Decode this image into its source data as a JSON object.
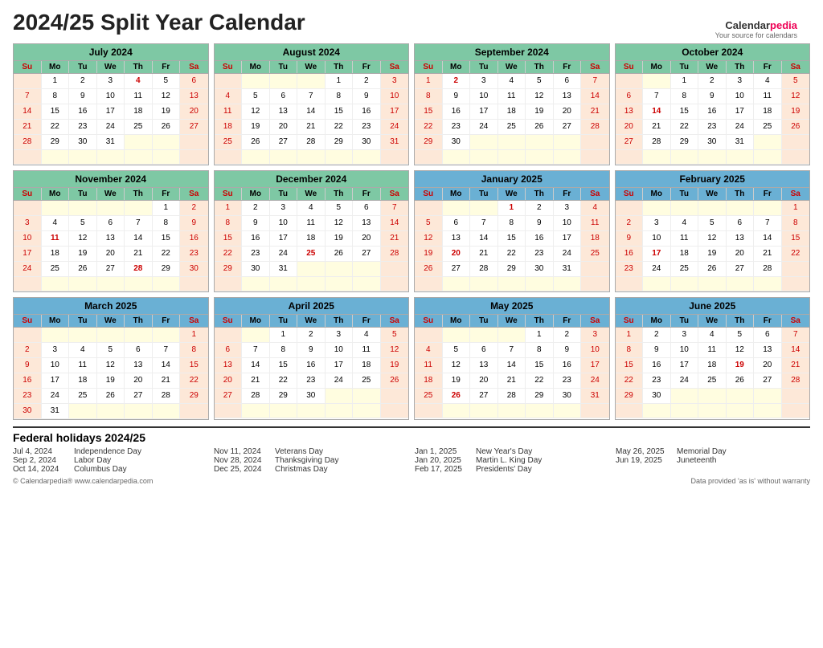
{
  "title": "2024/25 Split Year Calendar",
  "logo": {
    "text1": "Calendar",
    "text2": "pedia",
    "tagline": "Your source for calendars"
  },
  "months": [
    {
      "name": "July 2024",
      "headerClass": "green",
      "startDay": 1,
      "days": 31,
      "year": 2024,
      "holidays": [
        4
      ]
    },
    {
      "name": "August 2024",
      "headerClass": "green",
      "startDay": 4,
      "days": 31,
      "year": 2024,
      "holidays": []
    },
    {
      "name": "September 2024",
      "headerClass": "green",
      "startDay": 0,
      "days": 30,
      "year": 2024,
      "holidays": [
        2
      ]
    },
    {
      "name": "October 2024",
      "headerClass": "green",
      "startDay": 2,
      "days": 31,
      "year": 2024,
      "holidays": [
        14
      ]
    },
    {
      "name": "November 2024",
      "headerClass": "green",
      "startDay": 5,
      "days": 30,
      "year": 2024,
      "holidays": [
        11,
        28
      ]
    },
    {
      "name": "December 2024",
      "headerClass": "green",
      "startDay": 0,
      "days": 31,
      "year": 2024,
      "holidays": [
        25
      ]
    },
    {
      "name": "January 2025",
      "headerClass": "blue",
      "startDay": 3,
      "days": 31,
      "year": 2025,
      "holidays": [
        1,
        20
      ]
    },
    {
      "name": "February 2025",
      "headerClass": "blue",
      "startDay": 6,
      "days": 28,
      "year": 2025,
      "holidays": [
        17
      ]
    },
    {
      "name": "March 2025",
      "headerClass": "blue",
      "startDay": 6,
      "days": 31,
      "year": 2025,
      "holidays": []
    },
    {
      "name": "April 2025",
      "headerClass": "blue",
      "startDay": 2,
      "days": 30,
      "year": 2025,
      "holidays": []
    },
    {
      "name": "May 2025",
      "headerClass": "blue",
      "startDay": 4,
      "days": 31,
      "year": 2025,
      "holidays": [
        26
      ]
    },
    {
      "name": "June 2025",
      "headerClass": "blue",
      "startDay": 0,
      "days": 30,
      "year": 2025,
      "holidays": [
        19
      ]
    }
  ],
  "dayHeaders": [
    "Su",
    "Mo",
    "Tu",
    "We",
    "Th",
    "Fr",
    "Sa"
  ],
  "holidays": [
    {
      "date": "Jul 4, 2024",
      "name": "Independence Day"
    },
    {
      "date": "Sep 2, 2024",
      "name": "Labor Day"
    },
    {
      "date": "Oct 14, 2024",
      "name": "Columbus Day"
    },
    {
      "date": "Nov 11, 2024",
      "name": "Veterans Day"
    },
    {
      "date": "Nov 28, 2024",
      "name": "Thanksgiving Day"
    },
    {
      "date": "Dec 25, 2024",
      "name": "Christmas Day"
    },
    {
      "date": "Jan 1, 2025",
      "name": "New Year's Day"
    },
    {
      "date": "Jan 20, 2025",
      "name": "Martin L. King Day"
    },
    {
      "date": "Feb 17, 2025",
      "name": "Presidents' Day"
    },
    {
      "date": "May 26, 2025",
      "name": "Memorial Day"
    },
    {
      "date": "Jun 19, 2025",
      "name": "Juneteenth"
    }
  ],
  "footer": {
    "left": "© Calendarpedia®  www.calendarpedia.com",
    "right": "Data provided 'as is' without warranty"
  }
}
